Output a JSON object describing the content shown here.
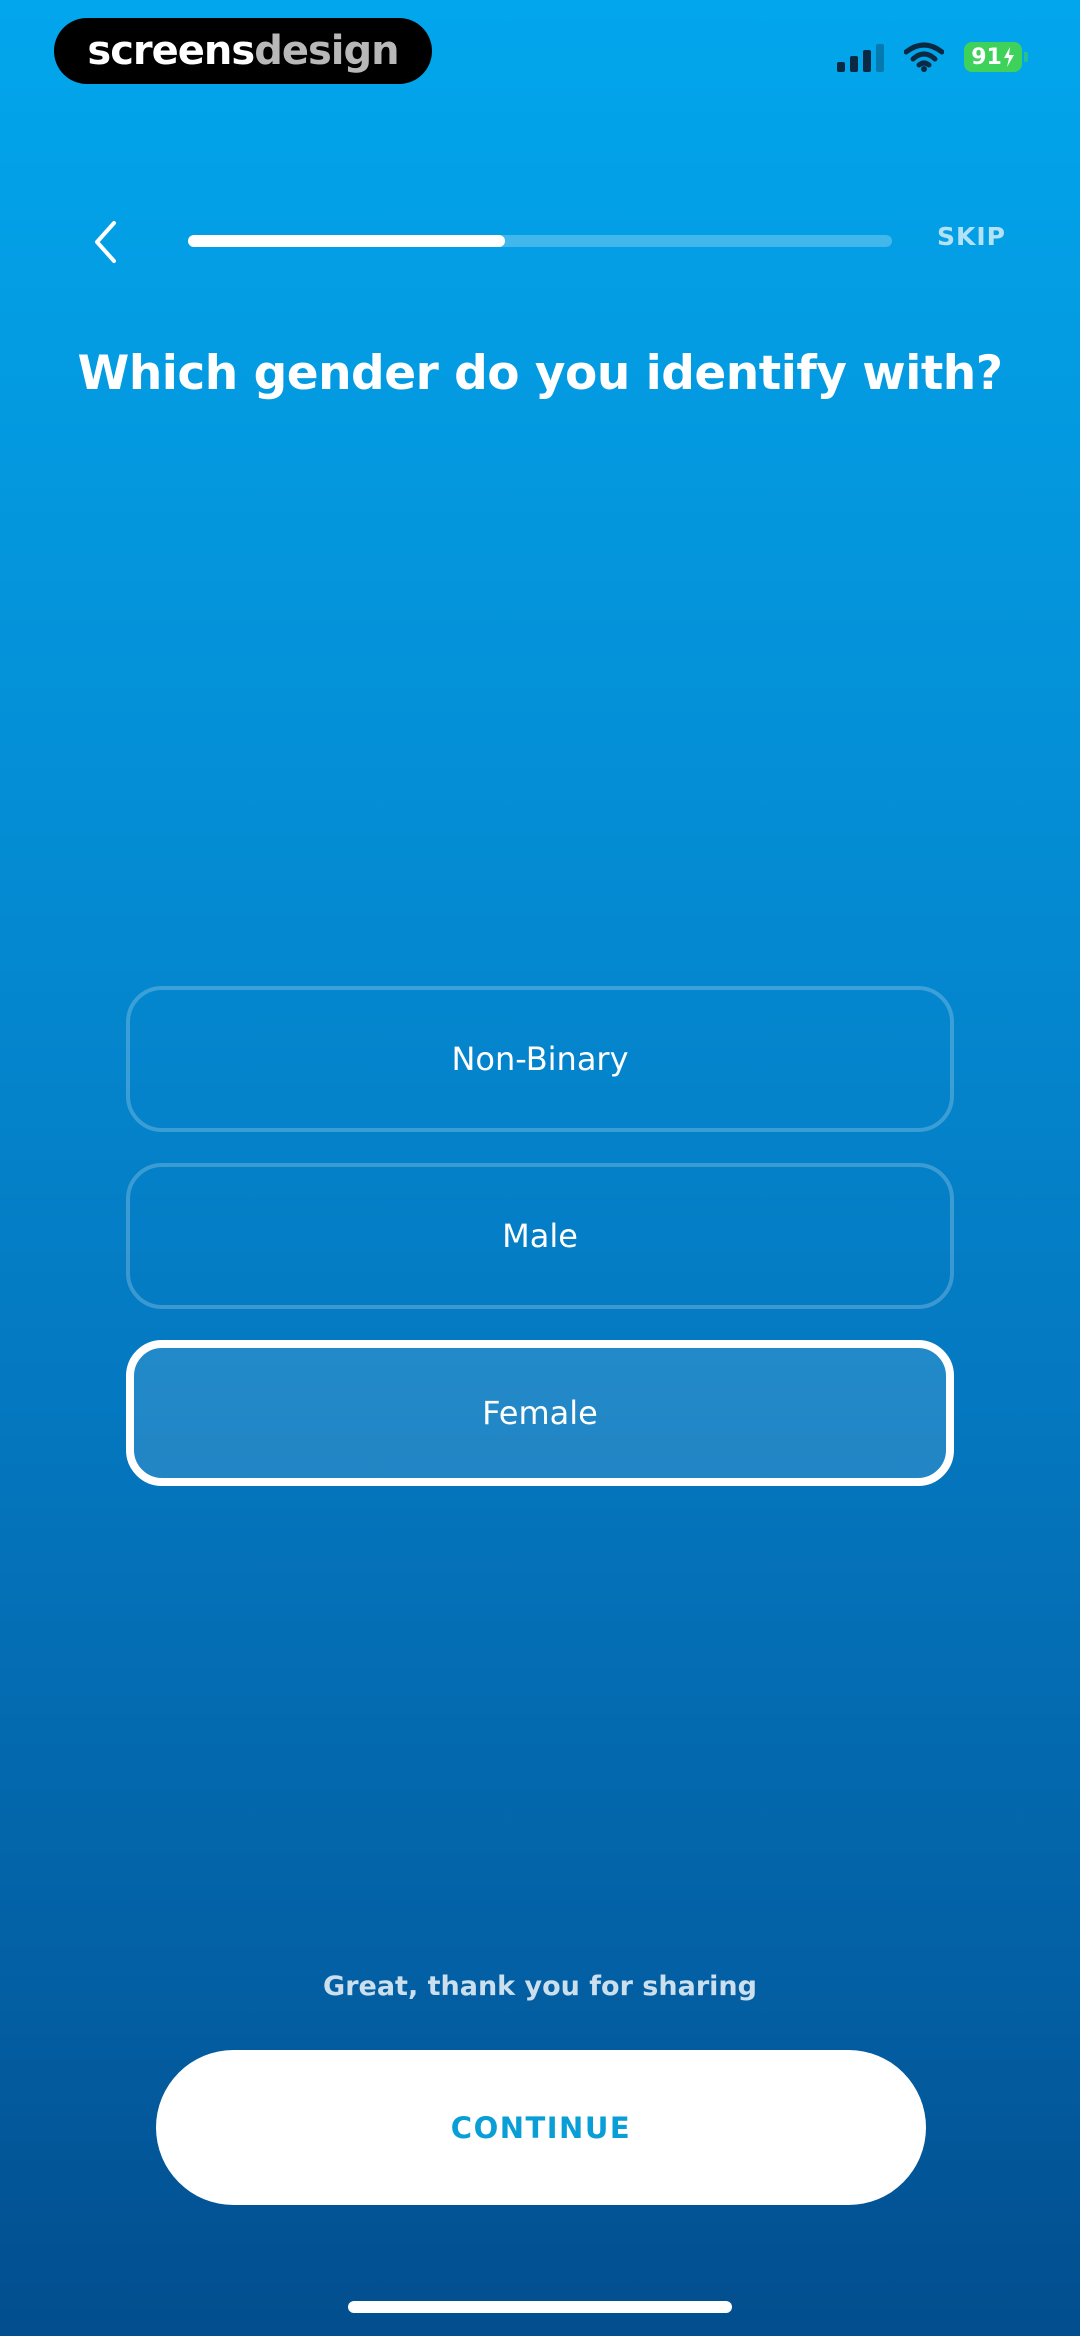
{
  "watermark": {
    "part1": "screens",
    "part2": "design"
  },
  "status_bar": {
    "battery": "91"
  },
  "header": {
    "skip_label": "SKIP",
    "progress": 0.45
  },
  "question": {
    "title": "Which gender do you identify with?"
  },
  "options": [
    {
      "label": "Non-Binary",
      "selected": false
    },
    {
      "label": "Male",
      "selected": false
    },
    {
      "label": "Female",
      "selected": true
    }
  ],
  "footer": {
    "message": "Great, thank you for sharing",
    "continue_label": "CONTINUE"
  },
  "colors": {
    "background_top": "#02a6ec",
    "background_bottom": "#024e8e",
    "accent": "#0a9ed6"
  }
}
